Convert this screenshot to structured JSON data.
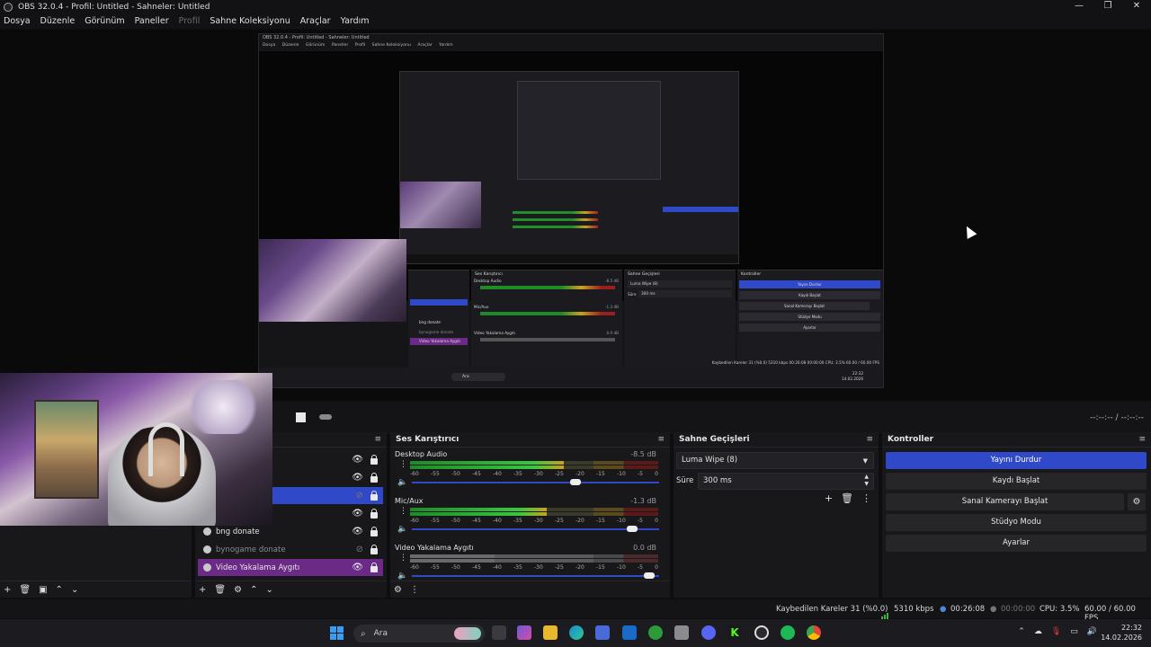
{
  "window": {
    "title": "OBS 32.0.4 - Profil: Untitled - Sahneler: Untitled",
    "controls": [
      "—",
      "❐",
      "✕"
    ]
  },
  "menu": [
    "Dosya",
    "Düzenle",
    "Görünüm",
    "Paneller",
    "Profil",
    "Sahne Koleksiyonu",
    "Araçlar",
    "Yardım"
  ],
  "nested_preview": {
    "title": "OBS 32.0.4 - Profil: Untitled - Sahneler: Untitled",
    "menu": [
      "Dosya",
      "Düzenle",
      "Görünüm",
      "Paneller",
      "Profil",
      "Sahne Koleksiyonu",
      "Araçlar",
      "Yardım"
    ],
    "mixer_title": "Ses Karıştırıcı",
    "transitions_title": "Sahne Geçişleri",
    "controls_title": "Kontroller",
    "transition": "Luma Wipe (8)",
    "duration_label": "Süre",
    "duration": "300 ms",
    "buttons": [
      "Yayını Durdur",
      "Kaydı Başlat",
      "Sanal Kamerayı Başlat",
      "Stüdyo Modu",
      "Ayarlar"
    ],
    "sources": [
      "bng donate",
      "bynogame donate",
      "Video Yakalama Aygıtı"
    ],
    "channels": [
      {
        "name": "Desktop Audio",
        "db": "-8.5 dB"
      },
      {
        "name": "Mic/Aux",
        "db": "-1.3 dB"
      },
      {
        "name": "Video Yakalama Aygıtı",
        "db": "0.0 dB"
      }
    ],
    "status": "Kaybedilen Kareler 31 (%0.0)   5310 kbps   00:26:08   00:00:00   CPU: 3.5%   60.00 / 60.00 FPS",
    "search": "Ara",
    "clock": "22:32",
    "date": "14.02.2026"
  },
  "preview_bar": {
    "timecode": "--:--:-- / --:--:--"
  },
  "sources": {
    "menu_icon": "≡",
    "items": [
      {
        "name": "",
        "visible": true,
        "locked": true,
        "selected": false,
        "highlight": false
      },
      {
        "name": "",
        "visible": true,
        "locked": true,
        "selected": false,
        "highlight": false
      },
      {
        "name": "",
        "visible": false,
        "locked": true,
        "selected": true,
        "highlight": false
      },
      {
        "name": "",
        "visible": true,
        "locked": true,
        "selected": false,
        "highlight": false
      },
      {
        "name": "bng donate",
        "visible": true,
        "locked": true,
        "selected": false,
        "highlight": false
      },
      {
        "name": "bynogame donate",
        "visible": false,
        "locked": true,
        "selected": false,
        "highlight": false
      },
      {
        "name": "Video Yakalama Aygıtı",
        "visible": true,
        "locked": true,
        "selected": false,
        "highlight": true
      }
    ],
    "footer": [
      "+",
      "🗑",
      "⚙",
      "⌃",
      "⌄"
    ]
  },
  "scenes": {
    "footer": [
      "+",
      "🗑",
      "▣",
      "⌃",
      "⌄"
    ]
  },
  "mixer": {
    "title": "Ses Karıştırıcı",
    "scale": [
      "-60",
      "-55",
      "-50",
      "-45",
      "-40",
      "-35",
      "-30",
      "-25",
      "-20",
      "-15",
      "-10",
      "-5",
      "0"
    ],
    "channels": [
      {
        "name": "Desktop Audio",
        "db": "-8.5 dB",
        "level": 0.62,
        "volume": 0.67
      },
      {
        "name": "Mic/Aux",
        "db": "-1.3 dB",
        "level": 0.55,
        "volume": 0.91
      },
      {
        "name": "Video Yakalama Aygıtı",
        "db": "0.0 dB",
        "level": 0.0,
        "volume": 0.98
      }
    ],
    "footer": [
      "⚙",
      "⋮"
    ]
  },
  "transitions": {
    "title": "Sahne Geçişleri",
    "selected": "Luma Wipe (8)",
    "duration_label": "Süre",
    "duration": "300 ms"
  },
  "controls": {
    "title": "Kontroller",
    "stream": "Yayını Durdur",
    "record": "Kaydı Başlat",
    "virtual_cam": "Sanal Kamerayı Başlat",
    "studio": "Stüdyo Modu",
    "settings": "Ayarlar"
  },
  "status": {
    "dropped": "Kaybedilen Kareler 31 (%0.0)",
    "bitrate": "5310 kbps",
    "stream_time": "00:26:08",
    "rec_time": "00:00:00",
    "cpu": "CPU: 3.5%",
    "fps": "60.00 / 60.00 FPS"
  },
  "taskbar": {
    "search": "Ara",
    "time": "22:32",
    "date": "14.02.2026",
    "apps": [
      "file-explorer",
      "copilot",
      "folder",
      "edge",
      "store",
      "outlook",
      "xbox",
      "settings",
      "discord",
      "kick",
      "obs",
      "spotify",
      "chrome"
    ]
  },
  "colors": {
    "accent": "#2f49c9",
    "highlight": "#6a2a86",
    "meter_green": "#1e8a28",
    "meter_yellow": "#c8a21c",
    "meter_red": "#9a1f1f"
  }
}
